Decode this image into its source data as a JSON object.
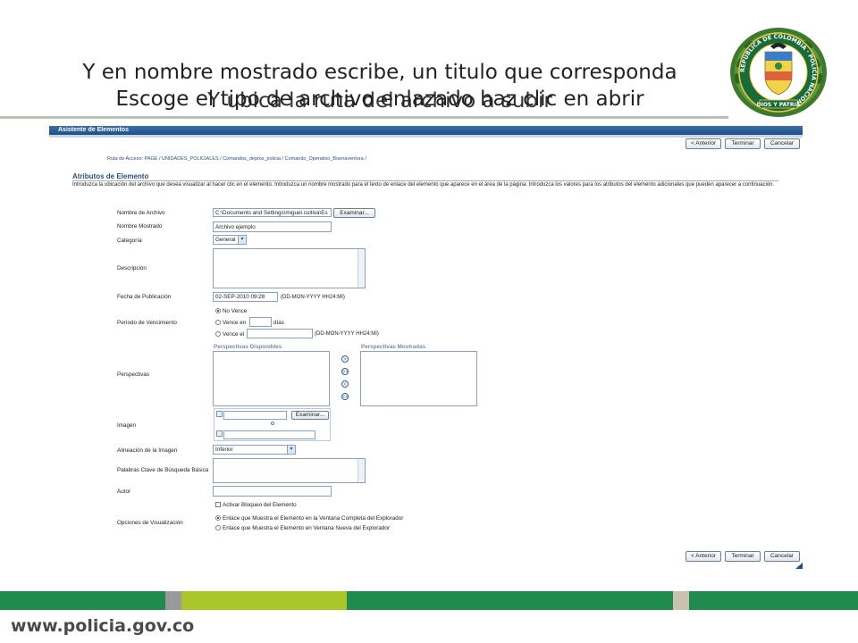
{
  "slide": {
    "title_line1": "Y en nombre mostrado escribe, un titulo que corresponda",
    "title_line2": "Escoge el tipo de archivo enlazado haz clic en abrir",
    "title_line3": "Y ubica la ruta del archivo a subir",
    "footer_url": "www.policia.gov.co",
    "colors": {
      "accent_green": "#1f8b4c",
      "lime": "#a9c52a",
      "footer_text": "#4a4a4a",
      "panel_header": "#1f4f86"
    }
  },
  "crest": {
    "ring_text": "REPÚBLICA DE COLOMBIA · POLICÍA NACIONAL ·",
    "motto": "DIOS Y PATRIA"
  },
  "app": {
    "header_title": "Asistente de Elementos",
    "buttons": {
      "previous": "< Anterior",
      "finish": "Terminar",
      "cancel": "Cancelar"
    },
    "breadcrumb": "Ruta de Acceso: PAGE / UNIDADES_POLICIALES / Comandos_deptos_policia / Comando_Operativo_Buenaventura /",
    "section_title": "Atributos de Elemento",
    "intro": "Introduzca la ubicación del archivo que desea visualizar al hacer clic en el elemento. Introduzca un nombre mostrado para el texto de enlace del elemento que aparece en el área de la página. Introduzca los valores para los atributos del elemento adicionales que pueden aparecer a continuación.",
    "fields": {
      "file_name_label": "Nombre de Archivo",
      "file_name_value": "C:\\Documents and Settings\\miguel.cuitiva\\Es",
      "browse_label": "Examinar...",
      "display_name_label": "Nombre Mostrado",
      "display_name_value": "Archivo ejemplo",
      "category_label": "Categoría",
      "category_value": "General",
      "description_label": "Descripción",
      "pub_date_label": "Fecha de Publicación",
      "pub_date_value": "02-SEP-2010 09:28",
      "pub_date_hint": "(DD-MON-YYYY HH24:MI)",
      "expiry_label": "Período de Vencimiento",
      "expiry_never": "No Vence",
      "expiry_in": "Vence en",
      "expiry_days": "días",
      "expiry_on": "Vence el",
      "expiry_on_hint": "(DD-MON-YYYY HH24:MI)",
      "perspectives_label": "Perspectivas",
      "available_label": "Perspectivas Disponibles",
      "shown_label": "Perspectivas Mostradas",
      "move_right": ">",
      "move_all_right": ">>",
      "move_left": "<",
      "move_all_left": "<<",
      "image_label": "Imagen",
      "image_browse": "Examinar...",
      "image_or": "o",
      "alignment_label": "Alineación de la Imagen",
      "alignment_value": "Inferior",
      "keywords_label": "Palabras Clave de Búsqueda Básica",
      "author_label": "Autor",
      "lock_label": "Activar Bloqueo del Elemento",
      "display_options_label": "Opciones de Visualización",
      "display_full": "Enlace que Muestra el Elemento en la Ventana Completa del Explorador",
      "display_new": "Enlace que Muestra el Elemento en Ventana Nueva del Explorador"
    }
  }
}
